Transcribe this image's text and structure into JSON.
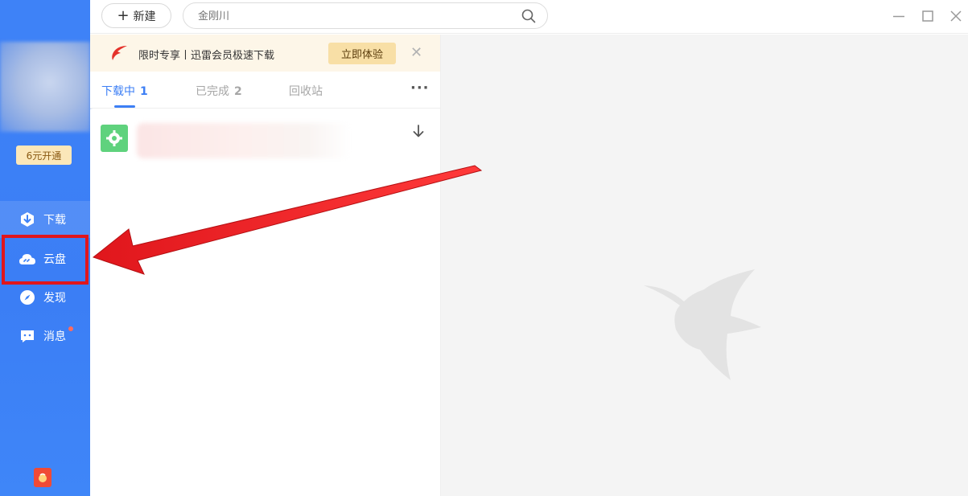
{
  "sidebar": {
    "vip_badge": "6元开通",
    "nav": [
      {
        "label": "下载",
        "icon": "download-shield-icon"
      },
      {
        "label": "云盘",
        "icon": "cloud-icon"
      },
      {
        "label": "发现",
        "icon": "compass-icon"
      },
      {
        "label": "消息",
        "icon": "message-icon"
      }
    ],
    "gift_icon": "red-packet-icon"
  },
  "topbar": {
    "new_label": "新建",
    "search_placeholder": "金刚川"
  },
  "banner": {
    "text": "限时专享丨迅雷会员极速下载",
    "button": "立即体验"
  },
  "tabs": [
    {
      "label": "下载中",
      "count": "1"
    },
    {
      "label": "已完成",
      "count": "2"
    },
    {
      "label": "回收站",
      "count": ""
    }
  ],
  "colors": {
    "sidebar": "#3e82f7",
    "accent": "#3d7ff5",
    "highlight": "#e0161c",
    "arrow": "#e8161b",
    "task_icon": "#5fd27d"
  }
}
